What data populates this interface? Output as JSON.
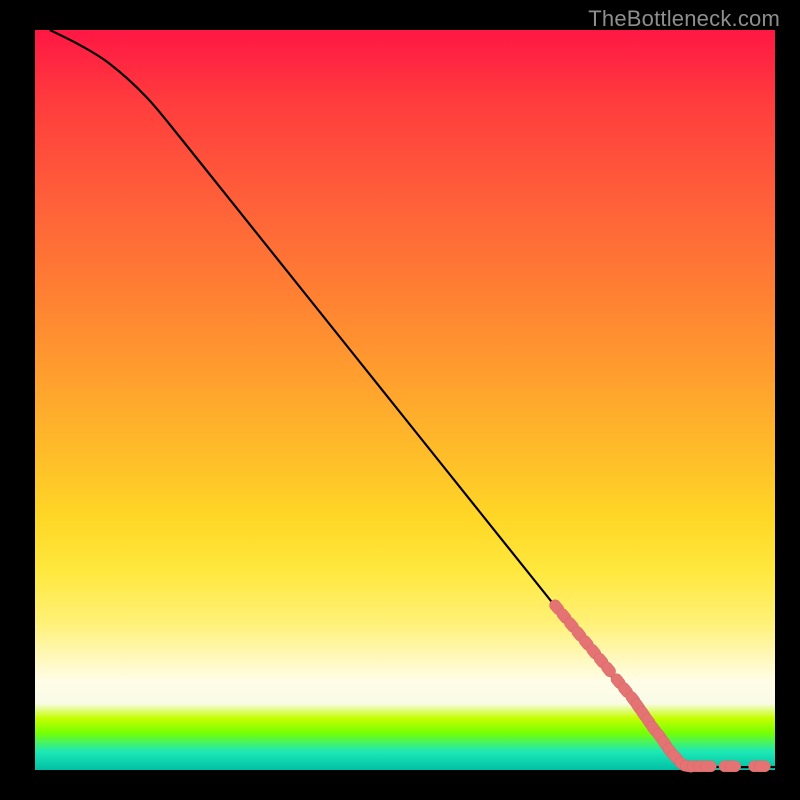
{
  "attribution": "TheBottleneck.com",
  "chart_data": {
    "type": "line",
    "title": "",
    "xlabel": "",
    "ylabel": "",
    "xlim": [
      0,
      100
    ],
    "ylim": [
      0,
      100
    ],
    "curve": [
      {
        "x": 2,
        "y": 100
      },
      {
        "x": 6,
        "y": 98
      },
      {
        "x": 10,
        "y": 95.5
      },
      {
        "x": 15,
        "y": 91
      },
      {
        "x": 20,
        "y": 85
      },
      {
        "x": 30,
        "y": 72.5
      },
      {
        "x": 40,
        "y": 60
      },
      {
        "x": 50,
        "y": 47.5
      },
      {
        "x": 60,
        "y": 35
      },
      {
        "x": 70,
        "y": 22.5
      },
      {
        "x": 78,
        "y": 12.5
      },
      {
        "x": 84,
        "y": 5
      },
      {
        "x": 87,
        "y": 1.5
      },
      {
        "x": 90,
        "y": 0.5
      },
      {
        "x": 100,
        "y": 0.4
      }
    ],
    "series": [
      {
        "name": "markers",
        "points": [
          {
            "x": 70.5,
            "y": 22.0
          },
          {
            "x": 71.5,
            "y": 20.8
          },
          {
            "x": 72.5,
            "y": 19.6
          },
          {
            "x": 73.5,
            "y": 18.4
          },
          {
            "x": 74.5,
            "y": 17.2
          },
          {
            "x": 75.5,
            "y": 16.0
          },
          {
            "x": 76.5,
            "y": 14.8
          },
          {
            "x": 77.5,
            "y": 13.6
          },
          {
            "x": 78.8,
            "y": 12.0
          },
          {
            "x": 79.8,
            "y": 10.8
          },
          {
            "x": 80.8,
            "y": 9.6
          },
          {
            "x": 81.5,
            "y": 8.6
          },
          {
            "x": 82.2,
            "y": 7.6
          },
          {
            "x": 82.9,
            "y": 6.6
          },
          {
            "x": 83.6,
            "y": 5.6
          },
          {
            "x": 84.4,
            "y": 4.6
          },
          {
            "x": 85.1,
            "y": 3.6
          },
          {
            "x": 85.8,
            "y": 2.6
          },
          {
            "x": 86.5,
            "y": 1.8
          },
          {
            "x": 87.5,
            "y": 0.8
          },
          {
            "x": 88.3,
            "y": 0.5
          },
          {
            "x": 89.2,
            "y": 0.5
          },
          {
            "x": 90.0,
            "y": 0.5
          },
          {
            "x": 91.0,
            "y": 0.5
          },
          {
            "x": 93.5,
            "y": 0.5
          },
          {
            "x": 94.3,
            "y": 0.5
          },
          {
            "x": 97.5,
            "y": 0.5
          },
          {
            "x": 98.3,
            "y": 0.5
          }
        ]
      }
    ]
  }
}
